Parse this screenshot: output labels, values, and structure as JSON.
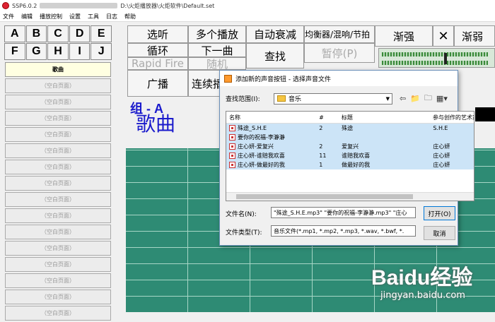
{
  "window": {
    "title_prefix": "SSP6.0.2",
    "path": "D:\\火炬播放器\\火炬软件\\Default.set"
  },
  "menu": [
    "文件",
    "编辑",
    "播放控制",
    "设置",
    "工具",
    "日志",
    "帮助"
  ],
  "letters": [
    "A",
    "B",
    "C",
    "D",
    "E",
    "F",
    "G",
    "H",
    "I",
    "J"
  ],
  "pages": [
    "歌曲",
    "（空白页面）",
    "（空白页面）",
    "（空白页面）",
    "（空白页面）",
    "（空白页面）",
    "（空白页面）",
    "（空白页面）",
    "（空白页面）",
    "（空白页面）",
    "（空白页面）",
    "（空白页面）",
    "（空白页面）",
    "（空白页面）",
    "（空白页面）",
    "（空白页面）"
  ],
  "controls": {
    "select": "选听",
    "multi": "多个播放",
    "auto_fade": "自动衰减",
    "eq": "均衡器/混响/节拍",
    "fade_in": "渐强",
    "close": "✕",
    "fade_out": "渐弱",
    "loop": "循环",
    "next": "下一曲",
    "search": "查找",
    "pause": "暂停(P)",
    "rapid_fire": "Rapid Fire",
    "random": "随机",
    "broadcast": "广播",
    "continuous": "连续播"
  },
  "group": {
    "label": "组 - A",
    "title": "歌曲"
  },
  "dialog": {
    "title": "添加新的声音按钮 - 选择声音文件",
    "look_in_label": "查找范围(I):",
    "look_in_value": "音乐",
    "columns": [
      "名称",
      "#",
      "标题",
      "参与创作的艺术家"
    ],
    "files": [
      {
        "name": "殊途_S.H.E",
        "num": "2",
        "title": "殊途",
        "artist": "S.H.E"
      },
      {
        "name": "要你的祝福-李瀞瀞",
        "num": "",
        "title": "",
        "artist": ""
      },
      {
        "name": "庄心妍-爱复兴",
        "num": "2",
        "title": "爱复兴",
        "artist": "庄心妍"
      },
      {
        "name": "庄心妍-谁赔我欢喜",
        "num": "11",
        "title": "谁赔我欢喜",
        "artist": "庄心妍"
      },
      {
        "name": "庄心妍-做最好的我",
        "num": "1",
        "title": "做最好的我",
        "artist": "庄心妍"
      }
    ],
    "filename_label": "文件名(N):",
    "filename_value": "\"殊途_S.H.E.mp3\" \"要你的祝福-李瀞瀞.mp3\" \"庄心",
    "filetype_label": "文件类型(T):",
    "filetype_value": "音乐文件(*.mp1, *.mp2, *.mp3, *.wav, *.bwf, *.",
    "open": "打开(O)",
    "cancel": "取消"
  },
  "watermark": {
    "brand": "Baidu经验",
    "url": "jingyan.baidu.com"
  }
}
